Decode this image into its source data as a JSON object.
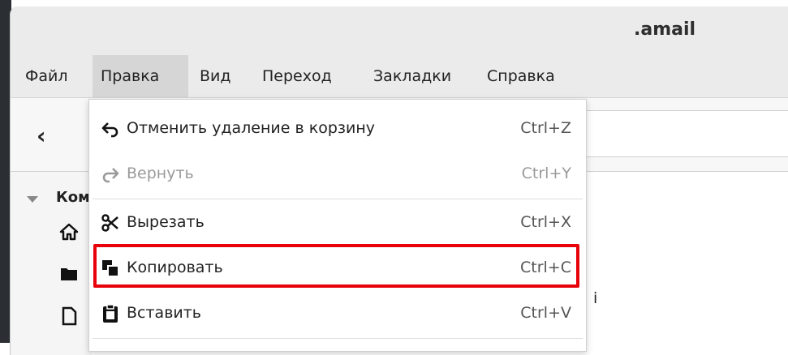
{
  "window": {
    "title": ".amail"
  },
  "menubar": {
    "items": [
      {
        "label": "Файл"
      },
      {
        "label": "Правка"
      },
      {
        "label": "Вид"
      },
      {
        "label": "Переход"
      },
      {
        "label": "Закладки"
      },
      {
        "label": "Справка"
      }
    ],
    "active_menu": "Правка"
  },
  "toolbar": {
    "back_icon": "chevron-left-icon"
  },
  "sidebar": {
    "section_label": "Ком",
    "icons": [
      "home-icon",
      "folder-icon",
      "file-icon"
    ]
  },
  "content": {
    "fragment_text": "i"
  },
  "edit_menu": {
    "items": [
      {
        "icon": "undo-icon",
        "label": "Отменить удаление в корзину",
        "shortcut": "Ctrl+Z",
        "enabled": true
      },
      {
        "icon": "redo-icon",
        "label": "Вернуть",
        "shortcut": "Ctrl+Y",
        "enabled": false
      },
      {
        "icon": "cut-icon",
        "label": "Вырезать",
        "shortcut": "Ctrl+X",
        "enabled": true
      },
      {
        "icon": "copy-icon",
        "label": "Копировать",
        "shortcut": "Ctrl+C",
        "enabled": true,
        "highlighted": true
      },
      {
        "icon": "paste-icon",
        "label": "Вставить",
        "shortcut": "Ctrl+V",
        "enabled": true
      }
    ]
  },
  "colors": {
    "highlight_border": "#e8000b",
    "active_menu_bg": "#d6d6d6"
  }
}
